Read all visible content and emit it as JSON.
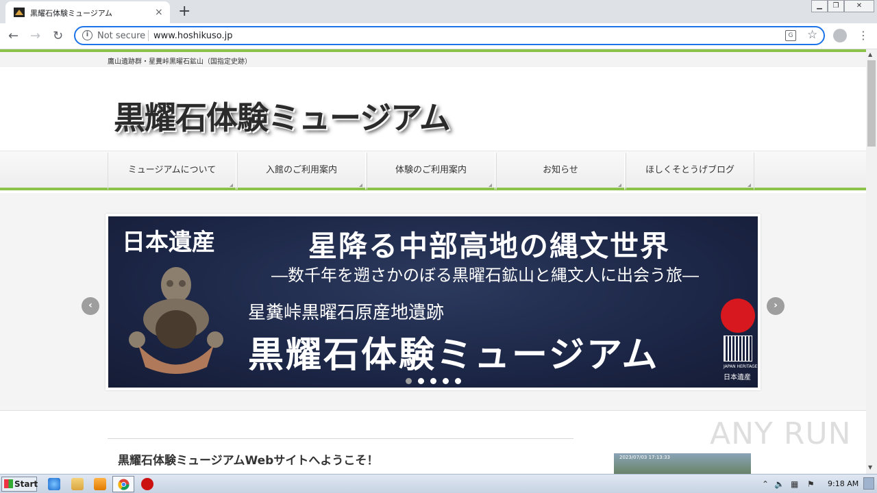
{
  "browser": {
    "tab_title": "黒耀石体験ミュージアム",
    "tab_close": "×",
    "new_tab": "+",
    "not_secure": "Not secure",
    "url": "www.hoshikuso.jp"
  },
  "site": {
    "subheader": "鷹山遺跡群・星糞峠黒曜石鉱山（国指定史跡）",
    "logo": "黒耀石体験ミュージアム",
    "nav": [
      {
        "label": "ミュージアムについて"
      },
      {
        "label": "入館のご利用案内"
      },
      {
        "label": "体験のご利用案内"
      },
      {
        "label": "お知らせ"
      },
      {
        "label": "ほしくそとうげブログ"
      }
    ],
    "slide": {
      "japan_heritage": "日本遺産",
      "title": "星降る中部高地の縄文世界",
      "subtitle": "―数千年を遡さかのぼる黒曜石鉱山と縄文人に出会う旅―",
      "site_name": "星糞峠黒曜石原産地遺跡",
      "museum_name": "黒耀石体験ミュージアム",
      "badge_caption": "JAPAN HERITAGE",
      "badge_name": "日本遺産",
      "active_dot": 1,
      "dot_count": 5
    },
    "welcome_heading": "黒耀石体験ミュージアムWebサイトへようこそ！",
    "webcam_timestamp": "2023/07/03 17:13:33"
  },
  "watermark": "ANY RUN",
  "taskbar": {
    "start_label": "Start",
    "clock": "9:18 AM"
  }
}
